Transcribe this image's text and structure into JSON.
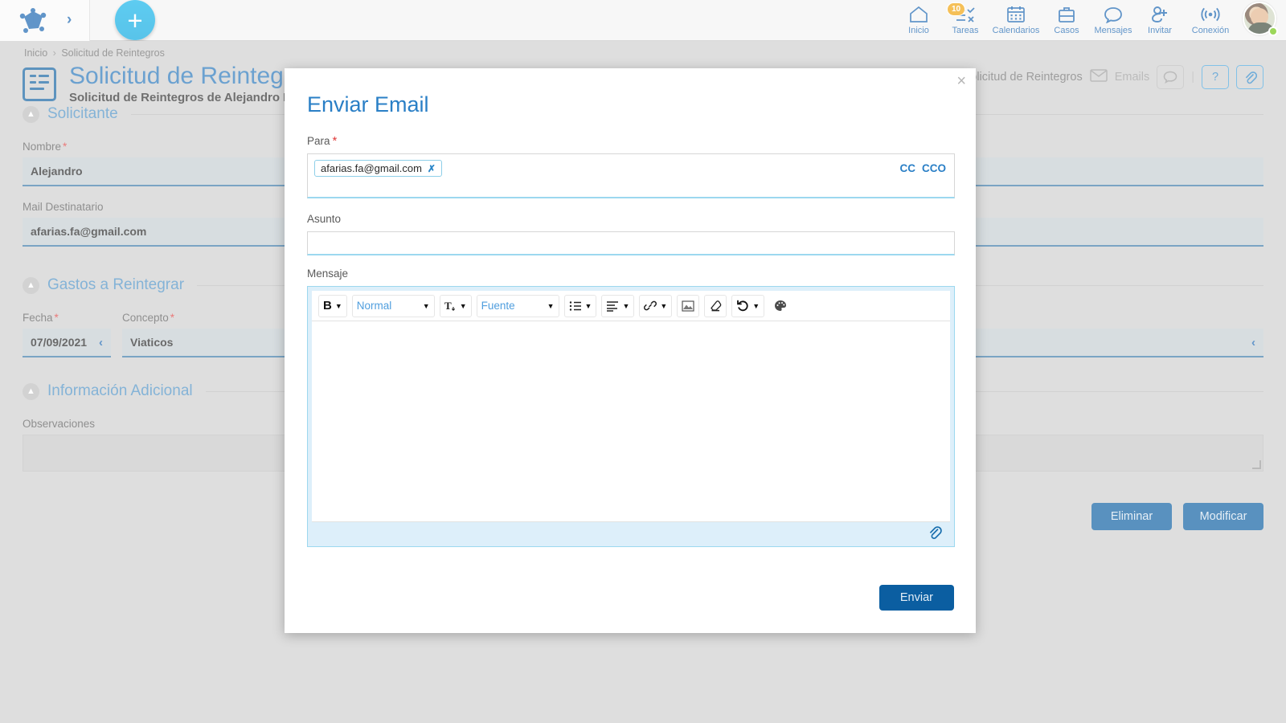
{
  "topbar": {
    "logo_name": "app-logo",
    "expand_label": "›",
    "create_label": "+",
    "nav": [
      {
        "id": "inicio",
        "label": "Inicio",
        "icon": "home-icon",
        "badge": null
      },
      {
        "id": "tareas",
        "label": "Tareas",
        "icon": "tasks-icon",
        "badge": "10"
      },
      {
        "id": "calendarios",
        "label": "Calendarios",
        "icon": "calendar-icon",
        "badge": null
      },
      {
        "id": "casos",
        "label": "Casos",
        "icon": "briefcase-icon",
        "badge": null
      },
      {
        "id": "mensajes",
        "label": "Mensajes",
        "icon": "chat-bubble-icon",
        "badge": null
      },
      {
        "id": "invitar",
        "label": "Invitar",
        "icon": "user-plus-icon",
        "badge": null
      },
      {
        "id": "conexion",
        "label": "Conexión",
        "icon": "broadcast-icon",
        "badge": null
      }
    ]
  },
  "page": {
    "breadcrumb": {
      "home": "Inicio",
      "separator": "›",
      "current": "Solicitud de Reintegros"
    },
    "title": "Solicitud de Reintegros",
    "subtitle": "Solicitud de Reintegros de Alejandro Faría",
    "header_right": {
      "tab_title": "Solicitud de Reintegros",
      "emails_label": "Emails",
      "help_label": "?",
      "separator": "|"
    },
    "sections": [
      {
        "id": "solicitante",
        "title": "Solicitante"
      },
      {
        "id": "gastos",
        "title": "Gastos a Reintegrar"
      },
      {
        "id": "informacion",
        "title": "Información Adicional"
      }
    ],
    "fields": {
      "nombre": {
        "label": "Nombre",
        "required": "*",
        "value": "Alejandro"
      },
      "mail_destinatario": {
        "label": "Mail Destinatario",
        "required": "",
        "value": "afarias.fa@gmail.com"
      },
      "fecha": {
        "label": "Fecha",
        "required": "*",
        "value": "07/09/2021",
        "chevron": "‹"
      },
      "concepto": {
        "label": "Concepto",
        "required": "*",
        "value": "Viaticos"
      },
      "observaciones": {
        "label": "Observaciones",
        "value": ""
      }
    },
    "actions": {
      "delete_label": "Eliminar",
      "modify_label": "Modificar"
    }
  },
  "modal": {
    "title": "Enviar Email",
    "close_label": "×",
    "to": {
      "label": "Para",
      "required": "*",
      "chips": [
        {
          "email": "afarias.fa@gmail.com",
          "remove_label": "✗"
        }
      ],
      "cc_label": "CC",
      "cco_label": "CCO"
    },
    "subject": {
      "label": "Asunto",
      "value": "",
      "placeholder": ""
    },
    "message": {
      "label": "Mensaje",
      "value": "",
      "toolbar": [
        {
          "id": "bold",
          "icon": "bold-icon",
          "label": "B",
          "caret": true
        },
        {
          "id": "style",
          "icon": "paragraph-style-icon",
          "label": "Normal",
          "caret": true
        },
        {
          "id": "fontsize",
          "icon": "font-size-icon",
          "label": "",
          "caret": true
        },
        {
          "id": "font",
          "icon": "font-family-icon",
          "label": "Fuente",
          "caret": true
        },
        {
          "id": "list",
          "icon": "bullet-list-icon",
          "label": "",
          "caret": true
        },
        {
          "id": "align",
          "icon": "align-left-icon",
          "label": "",
          "caret": true
        },
        {
          "id": "link",
          "icon": "link-icon",
          "label": "",
          "caret": true
        },
        {
          "id": "image",
          "icon": "image-icon",
          "label": "",
          "caret": false
        },
        {
          "id": "eraser",
          "icon": "eraser-icon",
          "label": "",
          "caret": false
        },
        {
          "id": "undo",
          "icon": "undo-icon",
          "label": "",
          "caret": true
        },
        {
          "id": "color",
          "icon": "palette-icon",
          "label": "",
          "caret": false
        }
      ],
      "attach_icon": "paperclip-icon"
    },
    "send_label": "Enviar"
  },
  "colors": {
    "accent_blue": "#0b5ea1",
    "link_blue": "#2a7fc6",
    "badge_orange": "#f0a30a",
    "cyan": "#0aa8e0",
    "required_red": "#e03b3b"
  }
}
